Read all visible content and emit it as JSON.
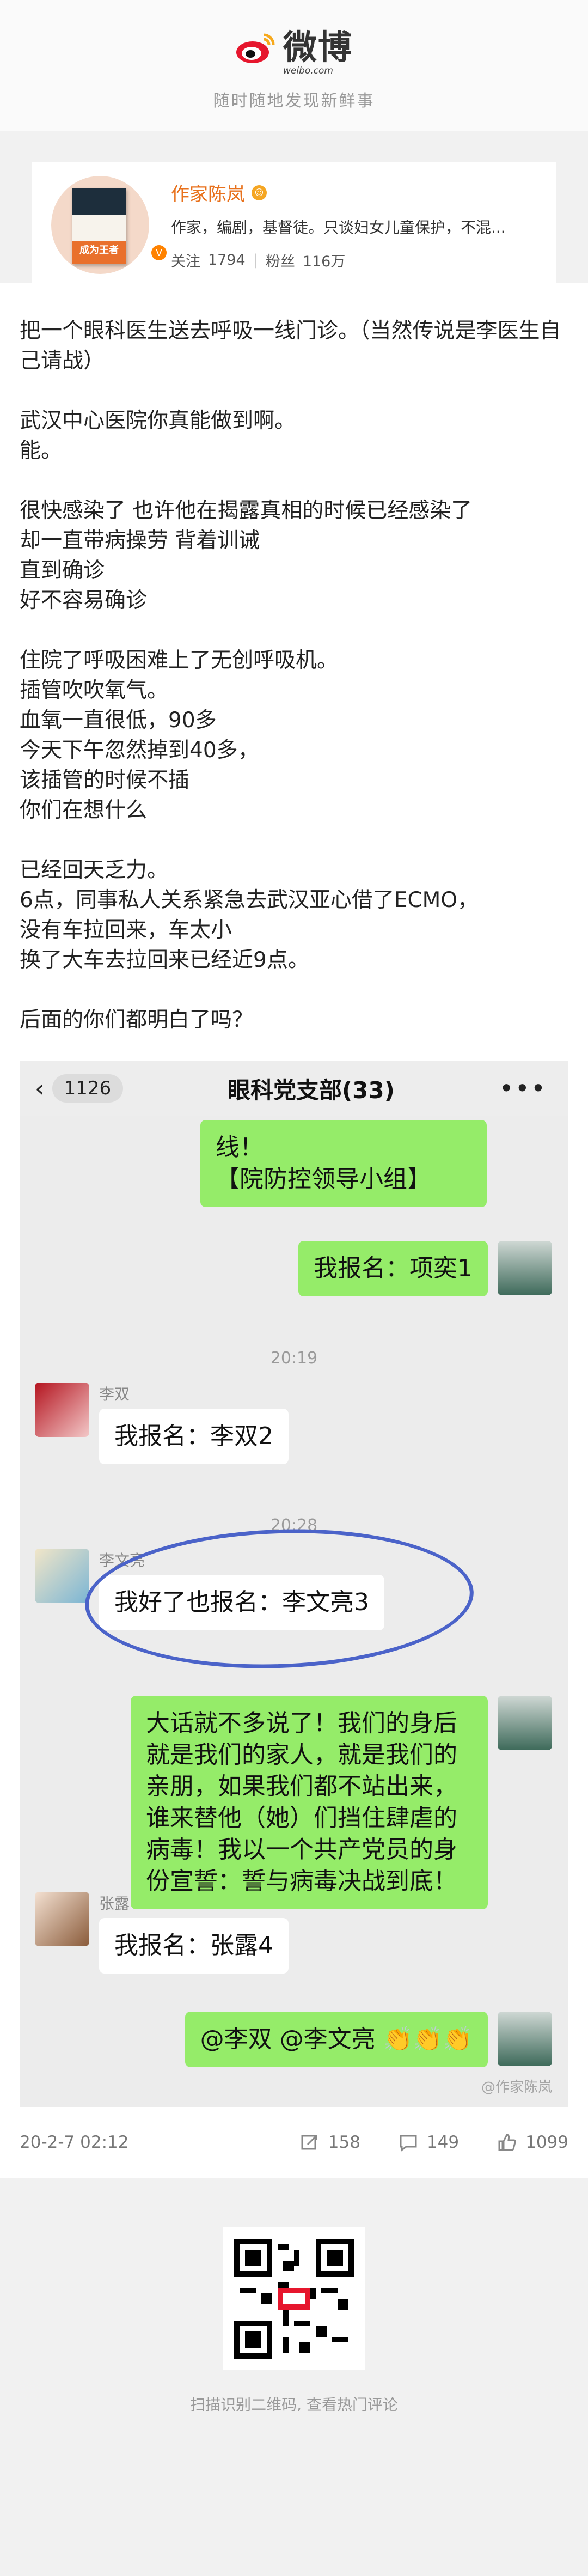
{
  "header": {
    "brand_name": "微博",
    "brand_sub": "weibo.com",
    "slogan": "随时随地发现新鲜事"
  },
  "profile": {
    "name": "作家陈岚",
    "bio": "作家，编剧，基督徒。只谈妇女儿童保护，不混...",
    "following_label": "关注",
    "following": "1794",
    "followers_label": "粉丝",
    "followers": "116万",
    "book_label": "成为王者"
  },
  "post": {
    "paragraphs": [
      "把一个眼科医生送去呼吸一线门诊。（当然传说是李医生自己请战）",
      "武汉中心医院你真能做到啊。\n能。",
      "很快感染了 也许他在揭露真相的时候已经感染了\n却一直带病操劳 背着训诫\n直到确诊\n好不容易确诊",
      "住院了呼吸困难上了无创呼吸机。\n插管吹吹氧气。\n血氧一直很低，90多\n今天下午忽然掉到40多，\n该插管的时候不插\n你们在想什么",
      "已经回天乏力。\n6点，同事私人关系紧急去武汉亚心借了ECMO，\n没有车拉回来，车太小\n换了大车去拉回来已经近9点。",
      "后面的你们都明白了吗？"
    ]
  },
  "chat": {
    "back_count": "1126",
    "title": "眼科党支部(33)",
    "more": "•••",
    "messages": {
      "m0": "线！\n【院防控领导小组】",
      "m1": "我报名：项奕1",
      "t1": "20:19",
      "s2": "李双",
      "m2": "我报名：李双2",
      "t2": "20:28",
      "s3": "李文亮",
      "m3": "我好了也报名：李文亮3",
      "m4": "大话就不多说了！我们的身后就是我们的家人，就是我们的亲朋，如果我们都不站出来，谁来替他（她）们挡住肆虐的病毒！我以一个共产党员的身份宣誓：誓与病毒决战到底！",
      "s5": "张露",
      "m5": "我报名：张露4",
      "m6": "@李双 @李文亮 👏👏👏"
    },
    "watermark": "@作家陈岚"
  },
  "footer": {
    "date": "20-2-7 02:12",
    "reposts": "158",
    "comments": "149",
    "likes": "1099"
  },
  "qr": {
    "caption": "扫描识别二维码, 查看热门评论"
  },
  "colors": {
    "accent": "#ff8200",
    "name": "#e8711c",
    "bubble_green": "#95ec69",
    "circle": "#4b63c9"
  }
}
